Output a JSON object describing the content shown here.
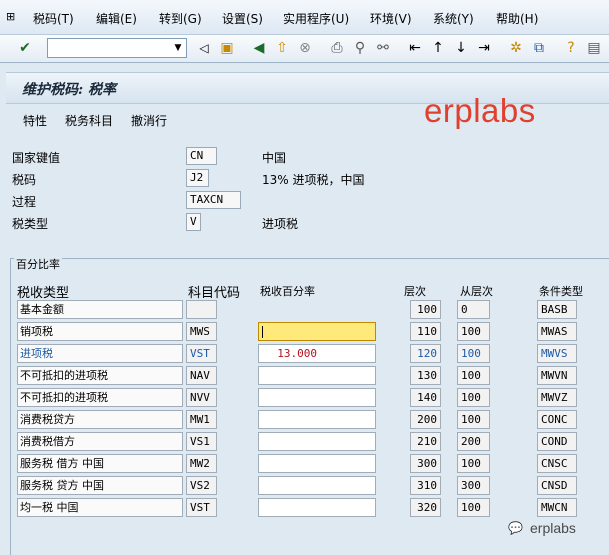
{
  "menu": [
    "税码(T)",
    "编辑(E)",
    "转到(G)",
    "设置(S)",
    "实用程序(U)",
    "环境(V)",
    "系统(Y)",
    "帮助(H)"
  ],
  "toolbar": {
    "command_value": "",
    "icons": [
      "check-icon",
      "back-triangle-icon",
      "save-icon",
      "back-icon",
      "exit-icon",
      "cancel-icon",
      "print-icon",
      "find-icon",
      "find-next-icon",
      "first-page-icon",
      "previous-page-icon",
      "next-page-icon",
      "last-page-icon",
      "new-session-icon",
      "shortcut-icon",
      "help-icon",
      "customize-layout-icon"
    ]
  },
  "title": "维护税码: 税率",
  "watermark": "erplabs",
  "app_toolbar": [
    "特性",
    "税务科目",
    "撤消行"
  ],
  "header": {
    "country_label": "国家键值",
    "country_value": "CN",
    "country_text": "中国",
    "taxcode_label": "税码",
    "taxcode_value": "J2",
    "taxcode_text": "13% 进项税，中国",
    "procedure_label": "过程",
    "procedure_value": "TAXCN",
    "taxtype_label": "税类型",
    "taxtype_value": "V",
    "taxtype_text": "进项税"
  },
  "group_title": "百分比率",
  "columns": {
    "tax_type": "税收类型",
    "account_key": "科目代码",
    "tax_percent": "税收百分率",
    "level": "层次",
    "from_level": "从层次",
    "cond_type": "条件类型"
  },
  "rows": [
    {
      "name": "基本金额",
      "key": "",
      "rate": "",
      "level": "100",
      "from": "0",
      "cond": "BASB"
    },
    {
      "name": "销项税",
      "key": "MWS",
      "rate": "",
      "level": "110",
      "from": "100",
      "cond": "MWAS"
    },
    {
      "name": "进项税",
      "key": "VST",
      "rate": "13.000",
      "level": "120",
      "from": "100",
      "cond": "MWVS"
    },
    {
      "name": "不可抵扣的进项税",
      "key": "NAV",
      "rate": "",
      "level": "130",
      "from": "100",
      "cond": "MWVN"
    },
    {
      "name": "不可抵扣的进项税",
      "key": "NVV",
      "rate": "",
      "level": "140",
      "from": "100",
      "cond": "MWVZ"
    },
    {
      "name": "消费税贷方",
      "key": "MW1",
      "rate": "",
      "level": "200",
      "from": "100",
      "cond": "CONC"
    },
    {
      "name": "消费税借方",
      "key": "VS1",
      "rate": "",
      "level": "210",
      "from": "200",
      "cond": "COND"
    },
    {
      "name": "服务税 借方 中国",
      "key": "MW2",
      "rate": "",
      "level": "300",
      "from": "100",
      "cond": "CNSC"
    },
    {
      "name": "服务税 贷方 中国",
      "key": "VS2",
      "rate": "",
      "level": "310",
      "from": "300",
      "cond": "CNSD"
    },
    {
      "name": "均一税 中国",
      "key": "VST",
      "rate": "",
      "level": "320",
      "from": "100",
      "cond": "MWCN"
    }
  ],
  "footer_watermark": "erplabs"
}
